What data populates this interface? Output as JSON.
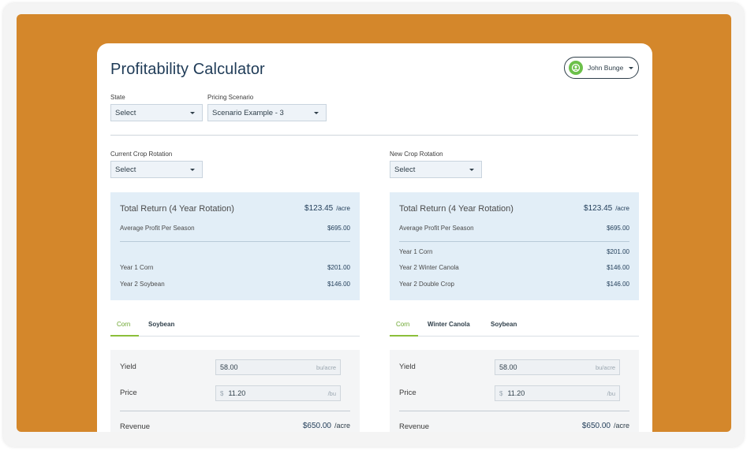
{
  "app": {
    "title": "Profitability Calculator"
  },
  "user": {
    "name": "John Bunge"
  },
  "filters": {
    "state": {
      "label": "State",
      "value": "Select"
    },
    "pricing": {
      "label": "Pricing Scenario",
      "value": "Scenario Example - 3"
    }
  },
  "left": {
    "rotation_label": "Current Crop Rotation",
    "rotation_value": "Select",
    "summary": {
      "title": "Total Return (4 Year Rotation)",
      "total": "$123.45",
      "unit": "/acre",
      "avg_label": "Average Profit Per Season",
      "avg_value": "$695.00",
      "years": [
        {
          "label": "Year 1 Corn",
          "value": "$201.00"
        },
        {
          "label": "Year 2 Soybean",
          "value": "$146.00"
        }
      ]
    },
    "tabs": [
      "Corn",
      "Soybean"
    ],
    "inputs": {
      "yield_label": "Yield",
      "yield_value": "58.00",
      "yield_unit": "bu/acre",
      "price_label": "Price",
      "price_currency": "$",
      "price_value": "11.20",
      "price_unit": "/bu",
      "revenue_label": "Revenue",
      "revenue_value": "$650.00",
      "revenue_unit": "/acre"
    }
  },
  "right": {
    "rotation_label": "New Crop Rotation",
    "rotation_value": "Select",
    "summary": {
      "title": "Total Return (4 Year Rotation)",
      "total": "$123.45",
      "unit": "/acre",
      "avg_label": "Average Profit Per Season",
      "avg_value": "$695.00",
      "years": [
        {
          "label": "Year 1 Corn",
          "value": "$201.00"
        },
        {
          "label": "Year 2 Winter Canola",
          "value": "$146.00"
        },
        {
          "label": "Year 2 Double Crop",
          "value": "$146.00"
        }
      ]
    },
    "tabs": [
      "Corn",
      "Winter Canola",
      "Soybean"
    ],
    "inputs": {
      "yield_label": "Yield",
      "yield_value": "58.00",
      "yield_unit": "bu/acre",
      "price_label": "Price",
      "price_currency": "$",
      "price_value": "11.20",
      "price_unit": "/bu",
      "revenue_label": "Revenue",
      "revenue_value": "$650.00",
      "revenue_unit": "/acre"
    }
  },
  "colors": {
    "background": "#d4872b",
    "accent": "#8bbf3a",
    "panel": "#e2eef7",
    "heading": "#1f3b57"
  }
}
